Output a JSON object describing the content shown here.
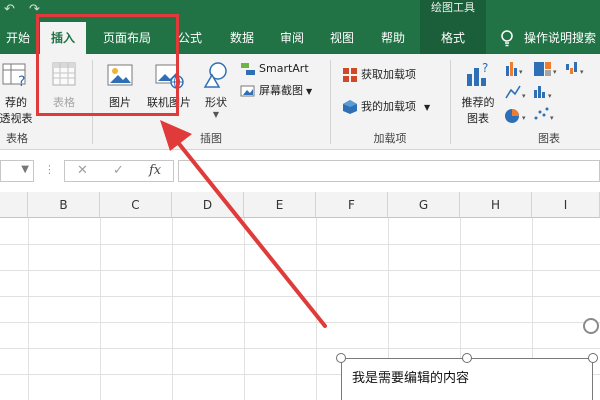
{
  "titlebar": {
    "qat_undo": "↶",
    "qat_redo": "↷",
    "context_tools": "绘图工具"
  },
  "tabs": [
    {
      "label": "开始"
    },
    {
      "label": "插入"
    },
    {
      "label": "页面布局"
    },
    {
      "label": "公式"
    },
    {
      "label": "数据"
    },
    {
      "label": "审阅"
    },
    {
      "label": "视图"
    },
    {
      "label": "帮助"
    },
    {
      "label": "格式"
    }
  ],
  "search_label": "操作说明搜索",
  "ribbon": {
    "tables": {
      "pivot_recommend_line1": "荐的",
      "pivot_recommend_line2": "透视表",
      "table_label": "表格",
      "group_label": "表格"
    },
    "illustrations": {
      "picture_label": "图片",
      "online_picture_label": "联机图片",
      "shapes_label": "形状",
      "smartart_label": "SmartArt",
      "screenshot_label": "屏幕截图",
      "group_label": "插图"
    },
    "addins": {
      "get_addins_label": "获取加载项",
      "my_addins_label": "我的加载项",
      "group_label": "加载项"
    },
    "charts": {
      "recommended_line1": "推荐的",
      "recommended_line2": "图表",
      "group_label": "图表"
    }
  },
  "formula": {
    "cancel": "✕",
    "enter": "✓",
    "fx": "fx",
    "dots": "⋮"
  },
  "columns": [
    "B",
    "C",
    "D",
    "E",
    "F",
    "G",
    "H",
    "I"
  ],
  "textbox": {
    "content": "我是需要编辑的内容"
  },
  "colors": {
    "excel_green": "#217346",
    "highlight_red": "#e03a3a"
  }
}
